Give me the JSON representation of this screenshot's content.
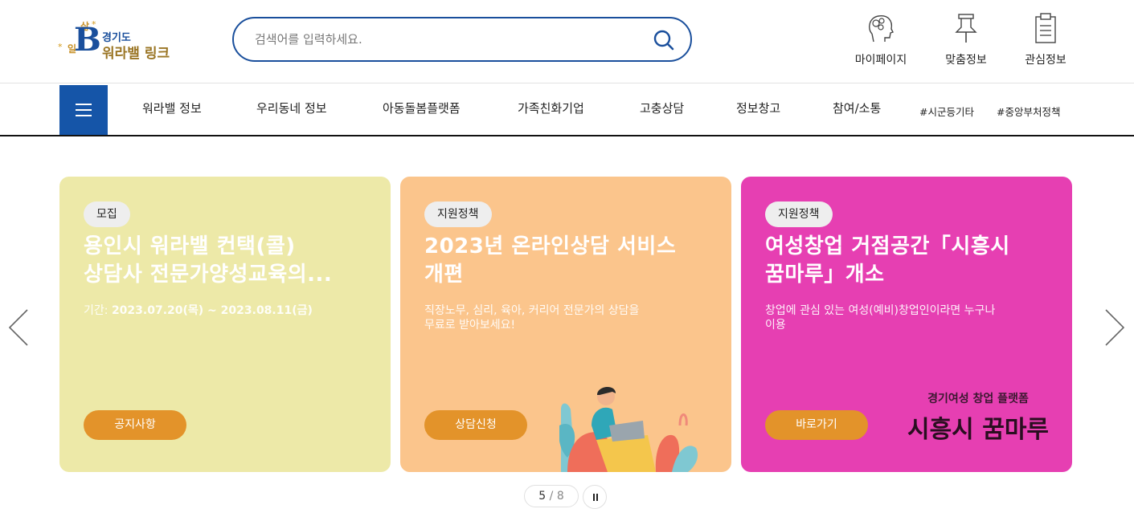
{
  "logo": {
    "glyph": "B",
    "sam": "삶",
    "il": "일",
    "star": "*",
    "line1": "경기도",
    "line2": "워라밸 링크"
  },
  "search": {
    "placeholder": "검색어를 입력하세요."
  },
  "utility_links": [
    {
      "label": "마이페이지",
      "icon": "user-head-icon"
    },
    {
      "label": "맞춤정보",
      "icon": "pushpin-icon"
    },
    {
      "label": "관심정보",
      "icon": "clipboard-icon"
    }
  ],
  "nav": {
    "items": [
      "워라밸 정보",
      "우리동네 정보",
      "아동돌봄플랫폼",
      "가족친화기업",
      "고충상담",
      "정보창고",
      "참여/소통"
    ],
    "tags": [
      "#시군등기타",
      "#중앙부처정책"
    ]
  },
  "slides": [
    {
      "badge": "모집",
      "title_line1": "용인시 워라밸 컨택(콜)",
      "title_line2": "상담사 전문가양성교육의...",
      "desc_label": "기간: ",
      "desc_value": "2023.07.20(목) ~ 2023.08.11(금)",
      "cta": "공지사항",
      "bg": "#ede9a8"
    },
    {
      "badge": "지원정책",
      "title_line1": "2023년 온라인상담 서비스",
      "title_line2": "개편",
      "desc_line1": "직장노무, 심리, 육아, 커리어 전문가의 상담을",
      "desc_line2": "무료로 받아보세요!",
      "cta": "상담신청",
      "bg": "#fbc58c",
      "illustration": "person-with-laptop-illustration"
    },
    {
      "badge": "지원정책",
      "title_line1": "여성창업 거점공간「시흥시",
      "title_line2": "꿈마루」개소",
      "desc_line1": "창업에 관심 있는 여성(예비)창업인이라면 누구나",
      "desc_line2": "이용",
      "cta": "바로가기",
      "bg": "#e63fb2",
      "brand_small": "경기여성 창업 플랫폼",
      "brand_large": "시흥시 꿈마루"
    }
  ],
  "pager": {
    "current": "5",
    "sep": " / ",
    "total": "8"
  },
  "colors": {
    "primary": "#1555a8",
    "accent_button": "#e3932a"
  }
}
